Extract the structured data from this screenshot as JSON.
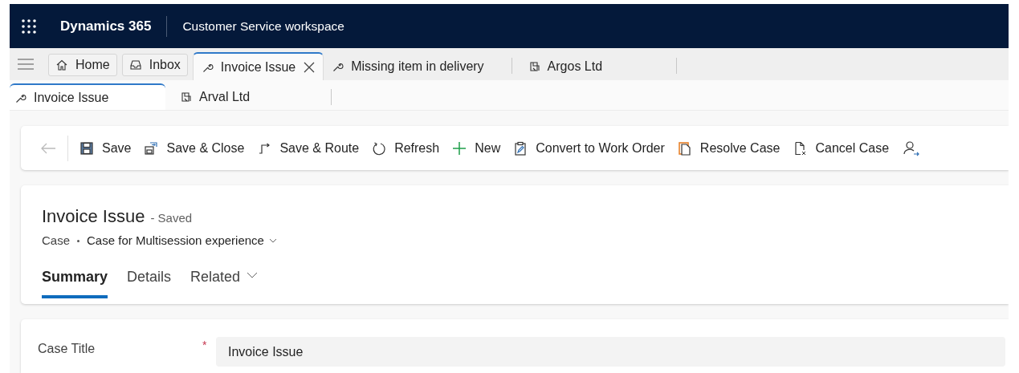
{
  "header": {
    "product": "Dynamics 365",
    "app": "Customer Service workspace"
  },
  "session_tabs": [
    {
      "kind": "home",
      "label": "Home",
      "selected": false
    },
    {
      "kind": "inbox",
      "label": "Inbox",
      "selected": false
    },
    {
      "kind": "case",
      "label": "Invoice Issue",
      "selected": true,
      "closable": true
    },
    {
      "kind": "case",
      "label": "Missing item in delivery",
      "selected": false,
      "closable": false
    },
    {
      "kind": "account",
      "label": "Argos Ltd",
      "selected": false,
      "closable": false
    }
  ],
  "app_tabs": [
    {
      "kind": "case",
      "label": "Invoice Issue",
      "selected": true
    },
    {
      "kind": "account",
      "label": "Arval Ltd",
      "selected": false
    }
  ],
  "commands": [
    {
      "kind": "save",
      "label": "Save"
    },
    {
      "kind": "save-close",
      "label": "Save & Close"
    },
    {
      "kind": "route",
      "label": "Save & Route"
    },
    {
      "kind": "refresh",
      "label": "Refresh"
    },
    {
      "kind": "new",
      "label": "New"
    },
    {
      "kind": "convert",
      "label": "Convert to Work Order"
    },
    {
      "kind": "resolve",
      "label": "Resolve Case"
    },
    {
      "kind": "cancel",
      "label": "Cancel Case"
    }
  ],
  "record": {
    "title": "Invoice Issue",
    "status": "- Saved",
    "entity": "Case",
    "form": "Case for Multisession experience"
  },
  "form_tabs": [
    {
      "label": "Summary",
      "selected": true,
      "dropdown": false
    },
    {
      "label": "Details",
      "selected": false,
      "dropdown": false
    },
    {
      "label": "Related",
      "selected": false,
      "dropdown": true
    }
  ],
  "fields": [
    {
      "label": "Case Title",
      "required_mark": "*",
      "value": "Invoice Issue"
    }
  ]
}
